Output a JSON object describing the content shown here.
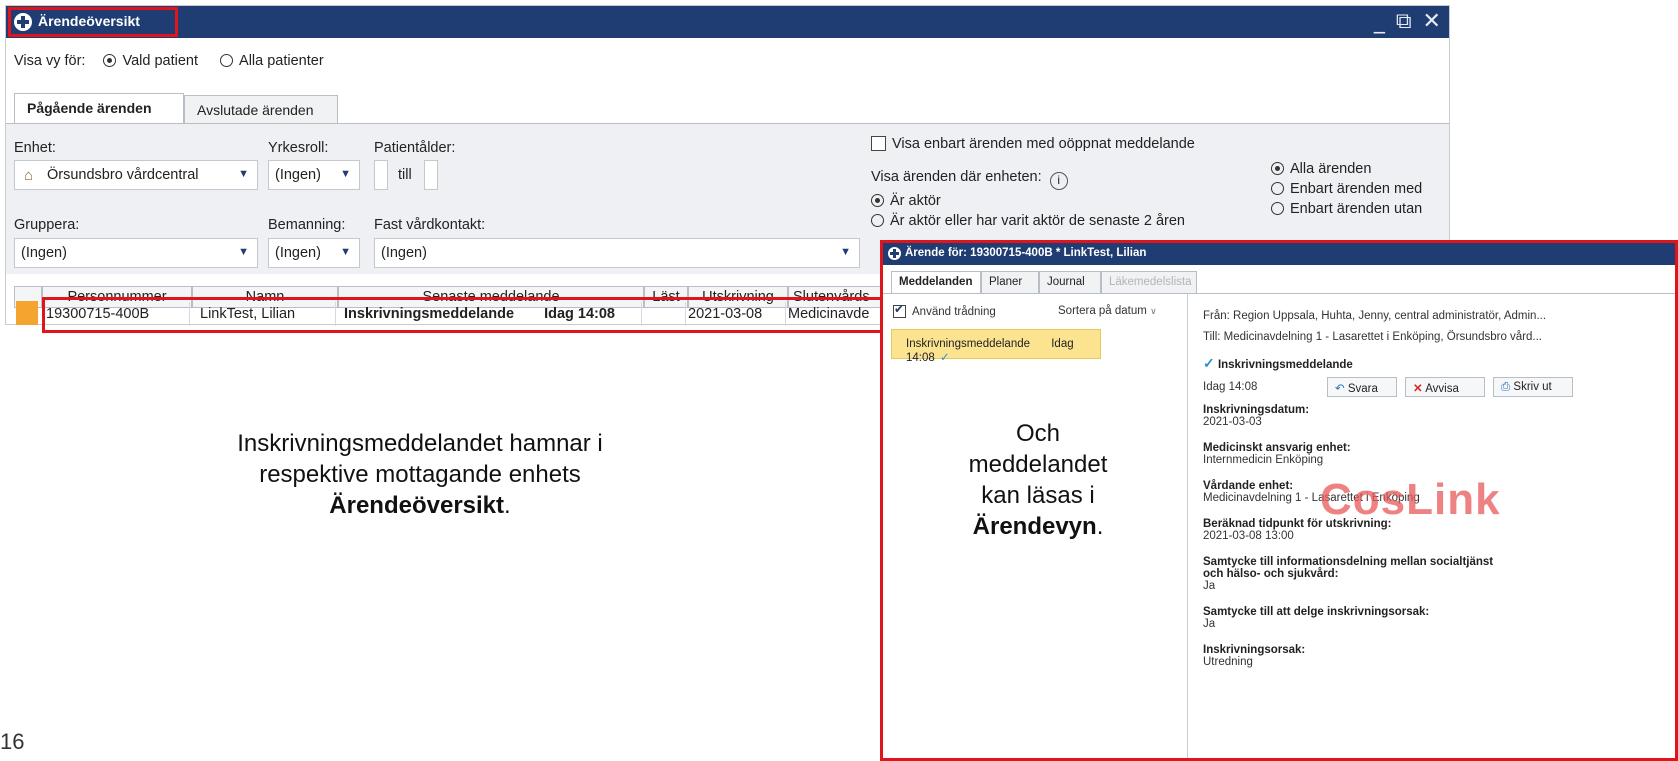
{
  "main_window": {
    "title": "Ärendeöversikt",
    "window_controls": "_ ⧉ ✕",
    "view_label": "Visa vy för:",
    "radio_selected_patient": "Vald patient",
    "radio_all_patients": "Alla patienter",
    "tabs": [
      "Pågående ärenden",
      "Avslutade ärenden"
    ],
    "filters": {
      "unit_label": "Enhet:",
      "unit_value": "Örsundsbro vårdcentral",
      "role_label": "Yrkesroll:",
      "role_value": "(Ingen)",
      "age_label": "Patientålder:",
      "age_to": "till",
      "group_label": "Gruppera:",
      "group_value": "(Ingen)",
      "staffing_label": "Bemanning:",
      "staffing_value": "(Ingen)",
      "contact_label": "Fast vårdkontakt:",
      "contact_value": "(Ingen)",
      "unopened_label": "Visa enbart ärenden med oöppnat meddelande",
      "show_where_label": "Visa ärenden där enheten:",
      "info_glyph": "i",
      "actor_option": "Är aktör",
      "actor_past_option": "Är aktör eller har varit aktör de senaste 2 åren",
      "all_cases": "Alla ärenden",
      "only_with": "Enbart ärenden med",
      "only_without": "Enbart ärenden utan"
    },
    "table": {
      "headers": [
        "Personnummer",
        "Namn",
        "Senaste meddelande",
        "Läst",
        "Utskrivning",
        "Slutenvårds"
      ],
      "row": {
        "personnummer": "19300715-400B",
        "namn": "LinkTest, Lilian",
        "meddelande": "Inskrivningsmeddelande",
        "meddelande_tid": "Idag 14:08",
        "last": "",
        "utskrivning": "2021-03-08",
        "slutenvard": "Medicinavde"
      }
    }
  },
  "sub_window": {
    "title": "Ärende för: 19300715-400B * LinkTest, Lilian",
    "tabs": [
      "Meddelanden",
      "Planer",
      "Journal",
      "Läkemedelslista"
    ],
    "use_threading": "Använd trådning",
    "sort_by": "Sortera på datum",
    "list_item_title": "Inskrivningsmeddelande",
    "list_item_time": "Idag 14:08",
    "from": "Från:  Region Uppsala, Huhta, Jenny, central administratör, Admin...",
    "to": "Till:    Medicinavdelning 1 - Lasarettet i Enköping, Örsundsbro vård...",
    "msg_heading": "Inskrivningsmeddelande",
    "msg_time": "Idag 14:08",
    "btn_reply": "Svara",
    "btn_reject": "Avvisa",
    "btn_print": "Skriv ut",
    "fields": [
      {
        "label": "Inskrivningsdatum:",
        "value": "2021-03-03"
      },
      {
        "label": "Medicinskt ansvarig enhet:",
        "value": "Internmedicin Enköping"
      },
      {
        "label": "Vårdande enhet:",
        "value": "Medicinavdelning 1 - Lasarettet i Enköping"
      },
      {
        "label": "Beräknad tidpunkt för utskrivning:",
        "value": "2021-03-08   13:00"
      },
      {
        "label": "Samtycke till informationsdelning mellan socialtjänst och hälso- och sjukvård:",
        "value": "Ja"
      },
      {
        "label": "Samtycke till att delge inskrivningsorsak:",
        "value": "Ja"
      },
      {
        "label": "Inskrivningsorsak:",
        "value": "Utredning"
      }
    ],
    "watermark": "CosLink"
  },
  "captions": {
    "left_line1": "Inskrivningsmeddelandet hamnar i",
    "left_line2": "respektive mottagande enhets",
    "left_bold": "Ärendeöversikt",
    "left_end": ".",
    "right_line1": "Och",
    "right_line2": "meddelandet",
    "right_line3": "kan läsas i",
    "right_bold": "Ärendevyn",
    "right_end": "."
  },
  "page_number": "16",
  "colors": {
    "titlebar": "#1f3d73",
    "highlight": "#e0151b",
    "selected_item": "#fbe390",
    "status_orange": "#f4a530"
  }
}
